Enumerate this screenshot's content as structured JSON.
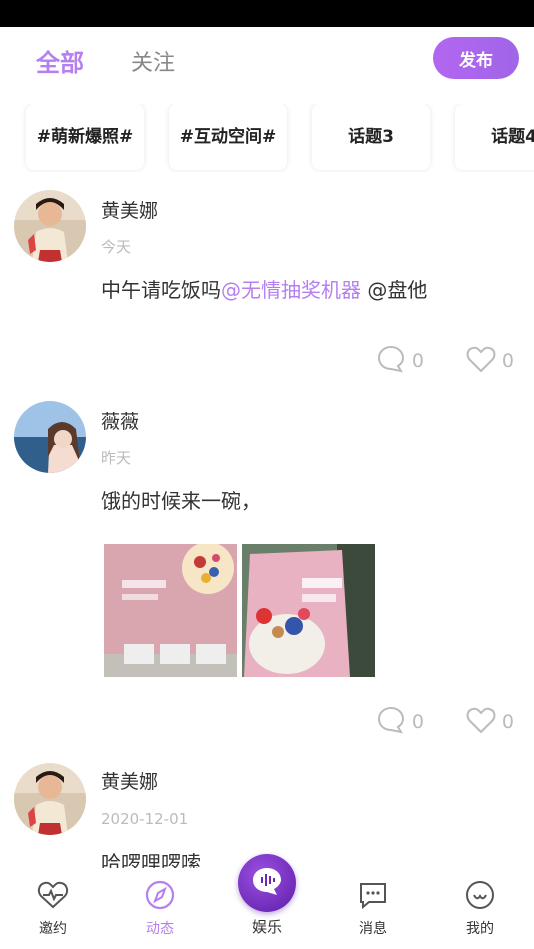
{
  "header": {
    "tabs": [
      "全部",
      "关注"
    ],
    "publish_label": "发布"
  },
  "topics": [
    "#萌新爆照#",
    "#互动空间#",
    "话题3",
    "话题4"
  ],
  "posts": [
    {
      "username": "黄美娜",
      "time": "今天",
      "text_before": "中午请吃饭吗",
      "mention": "@无情抽奖机器",
      "text_after": " @盘他",
      "comments": "0",
      "likes": "0"
    },
    {
      "username": "薇薇",
      "time": "昨天",
      "text": "饿的时候来一碗，",
      "comments": "0",
      "likes": "0"
    },
    {
      "username": "黄美娜",
      "time": "2020-12-01",
      "text": "哈啰哩啰嗦"
    }
  ],
  "nav": {
    "items": [
      "邀约",
      "动态",
      "娱乐",
      "消息",
      "我的"
    ],
    "active_color": "#b57ff0"
  },
  "colors": {
    "accent": "#b57ff0",
    "publish": "#a766ef"
  }
}
